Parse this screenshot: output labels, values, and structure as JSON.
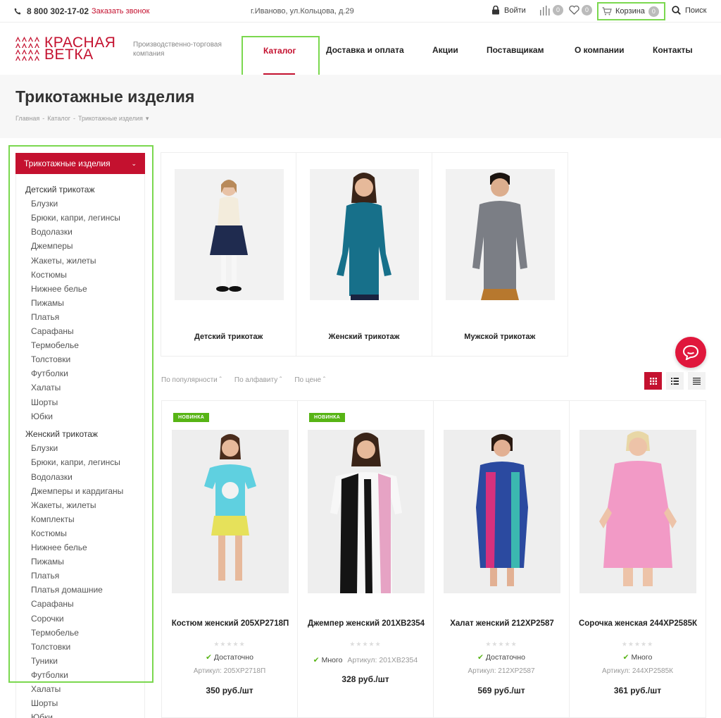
{
  "topbar": {
    "phone": "8 800 302-17-02",
    "callback": "Заказать звонок",
    "address": "г.Иваново, ул.Кольцова, д.29",
    "login": "Войти",
    "compare_count": "0",
    "fav_count": "0",
    "cart_label": "Корзина",
    "cart_count": "0",
    "search_label": "Поиск"
  },
  "header": {
    "logo_line1": "КРАСНАЯ",
    "logo_line2": "ВЕТКА",
    "tagline": "Производственно-торговая компания",
    "nav": [
      "Каталог",
      "Доставка и оплата",
      "Акции",
      "Поставщикам",
      "О компании",
      "Контакты"
    ]
  },
  "page": {
    "title": "Трикотажные изделия",
    "breadcrumb": [
      "Главная",
      "-",
      "Каталог",
      "-",
      "Трикотажные изделия",
      "▾"
    ]
  },
  "sidebar": {
    "heading": "Трикотажные изделия",
    "groups": [
      {
        "label": "Детский трикотаж",
        "items": [
          "Блузки",
          "Брюки, капри, легинсы",
          "Водолазки",
          "Джемперы",
          "Жакеты, жилеты",
          "Костюмы",
          "Нижнее белье",
          "Пижамы",
          "Платья",
          "Сарафаны",
          "Термобелье",
          "Толстовки",
          "Футболки",
          "Халаты",
          "Шорты",
          "Юбки"
        ]
      },
      {
        "label": "Женский трикотаж",
        "items": [
          "Блузки",
          "Брюки, капри, легинсы",
          "Водолазки",
          "Джемперы и кардиганы",
          "Жакеты, жилеты",
          "Комплекты",
          "Костюмы",
          "Нижнее белье",
          "Пижамы",
          "Платья",
          "Платья домашние",
          "Сарафаны",
          "Сорочки",
          "Термобелье",
          "Толстовки",
          "Туники",
          "Футболки",
          "Халаты",
          "Шорты",
          "Юбки"
        ]
      }
    ]
  },
  "categories": [
    {
      "name": "Детский трикотаж"
    },
    {
      "name": "Женский трикотаж"
    },
    {
      "name": "Мужской трикотаж"
    }
  ],
  "sort": {
    "options": [
      "По популярности",
      "По алфавиту",
      "По цене"
    ]
  },
  "products": [
    {
      "badge": "НОВИНКА",
      "name": "Костюм женский 205ХР2718П",
      "availability": "Достаточно",
      "article": "Артикул: 205ХР2718П",
      "price": "350 руб./шт"
    },
    {
      "badge": "НОВИНКА",
      "name": "Джемпер женский 201ХВ2354",
      "availability": "Много",
      "article": "Артикул: 201ХВ2354",
      "price": "328 руб./шт"
    },
    {
      "badge": "",
      "name": "Халат женский 212ХР2587",
      "availability": "Достаточно",
      "article": "Артикул: 212ХР2587",
      "price": "569 руб./шт"
    },
    {
      "badge": "",
      "name": "Сорочка женская 244ХР2585К",
      "availability": "Много",
      "article": "Артикул: 244ХР2585К",
      "price": "361 руб./шт"
    }
  ],
  "colors": {
    "accent": "#c4112f",
    "new_badge": "#57b415",
    "highlight_frame": "#7bd84f"
  }
}
